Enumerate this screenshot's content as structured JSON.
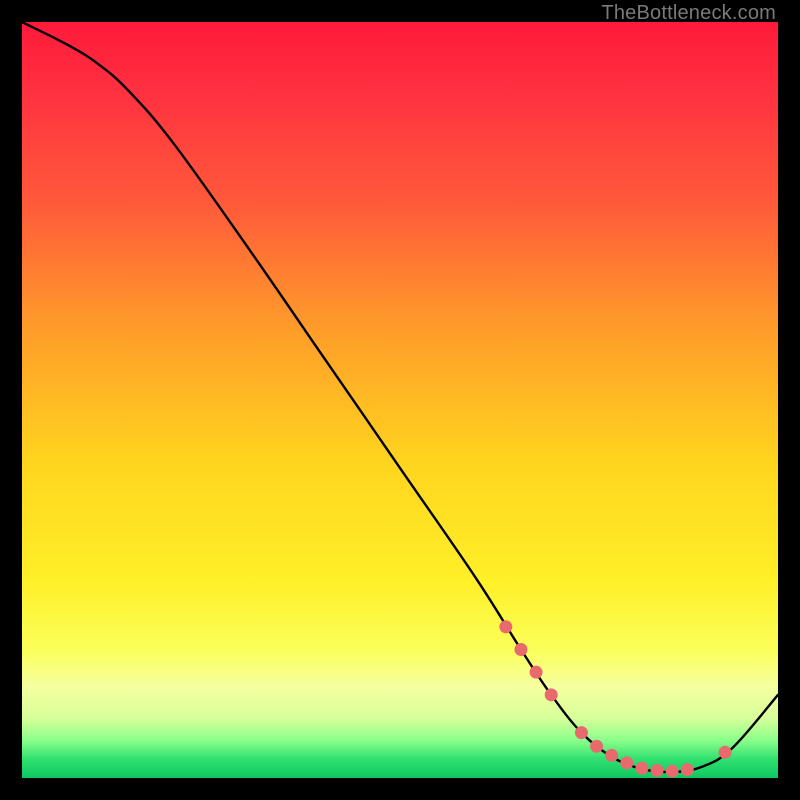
{
  "watermark": "TheBottleneck.com",
  "chart_data": {
    "type": "line",
    "title": "",
    "xlabel": "",
    "ylabel": "",
    "xlim": [
      0,
      100
    ],
    "ylim": [
      0,
      100
    ],
    "series": [
      {
        "name": "curve",
        "x": [
          0,
          6,
          10,
          14,
          20,
          30,
          40,
          50,
          60,
          66,
          70,
          74,
          78,
          82,
          86,
          90,
          94,
          100
        ],
        "y": [
          100,
          97,
          94.5,
          91,
          84,
          70,
          55.5,
          41,
          26.5,
          17,
          11,
          6,
          2.8,
          1.2,
          0.8,
          1.5,
          4,
          11
        ]
      }
    ],
    "markers": {
      "name": "highlight-dots",
      "x": [
        64,
        66,
        68,
        70,
        74,
        76,
        78,
        80,
        82,
        84,
        86,
        88,
        93
      ],
      "y": [
        20,
        17,
        14,
        11,
        6,
        4.2,
        3.0,
        2.0,
        1.3,
        1.0,
        0.9,
        1.1,
        3.4
      ]
    },
    "gradient_stops": [
      {
        "pos": 0.0,
        "color": "#ff1a3a"
      },
      {
        "pos": 0.24,
        "color": "#ff5a3a"
      },
      {
        "pos": 0.58,
        "color": "#ffd41e"
      },
      {
        "pos": 0.83,
        "color": "#fbff5a"
      },
      {
        "pos": 0.95,
        "color": "#8cff8c"
      },
      {
        "pos": 1.0,
        "color": "#10c860"
      }
    ]
  }
}
